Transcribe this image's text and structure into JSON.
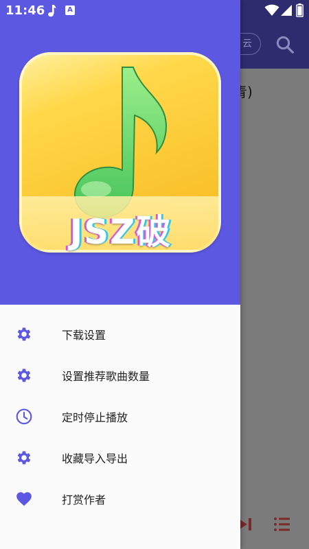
{
  "status_bar": {
    "time": "11:46",
    "notification_app_letter": "A"
  },
  "background": {
    "pill_text": "云",
    "song_fragment": "青)"
  },
  "drawer": {
    "logo_text": "JSZ破",
    "header_color": "#5c58e2",
    "menu": [
      {
        "label": "下载设置",
        "icon": "gear-icon"
      },
      {
        "label": "设置推荐歌曲数量",
        "icon": "gear-icon"
      },
      {
        "label": "定时停止播放",
        "icon": "clock-icon"
      },
      {
        "label": "收藏导入导出",
        "icon": "gear-icon"
      },
      {
        "label": "打赏作者",
        "icon": "heart-icon"
      }
    ]
  },
  "colors": {
    "accent": "#5c58e2",
    "icon": "#5c58e2",
    "player_controls": "#b23b3b"
  }
}
